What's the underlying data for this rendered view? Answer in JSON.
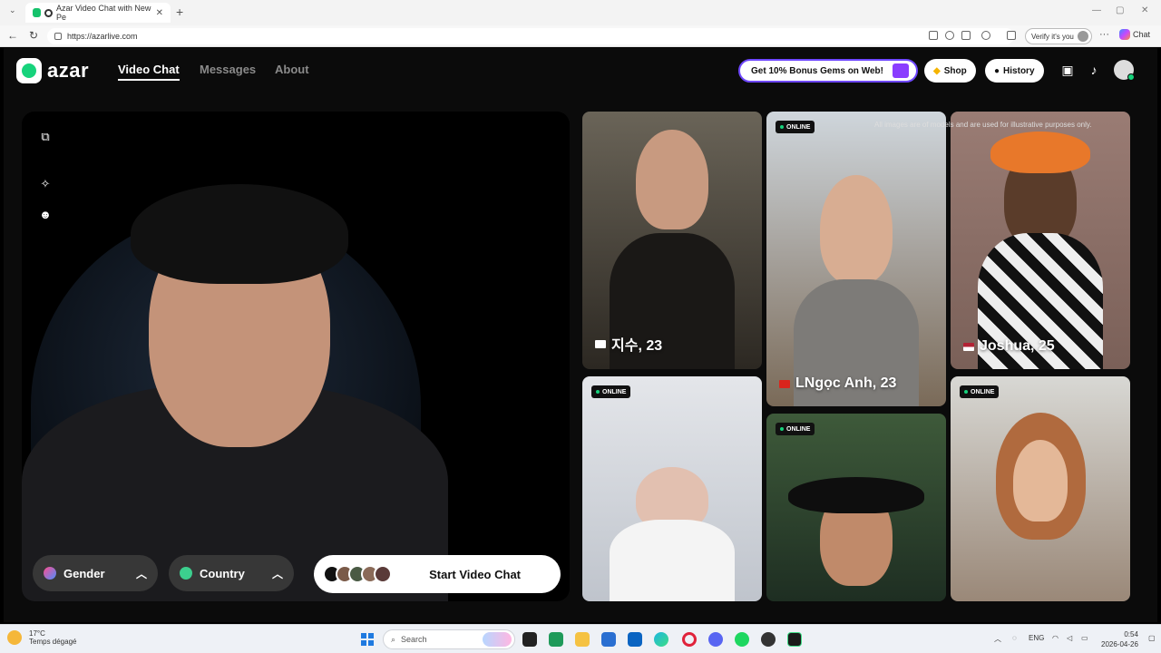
{
  "browser": {
    "tab_title": "Azar Video Chat with New Pe",
    "url": "https://azarlive.com",
    "verify_label": "Verify it's you",
    "copilot_label": "Chat"
  },
  "nav": {
    "logo_text": "azar",
    "links": [
      "Video Chat",
      "Messages",
      "About"
    ],
    "promo": "Get 10% Bonus Gems on Web!",
    "shop": "Shop",
    "history": "History"
  },
  "filters": {
    "gender": "Gender",
    "country": "Country",
    "start": "Start Video Chat"
  },
  "disclaimer": "All images are of models and are used for illustrative purposes only.",
  "profiles": [
    {
      "name": "지수, 23",
      "flag_color": "#ffffff",
      "online": false
    },
    {
      "name": "LNgọc Anh, 23",
      "flag_color": "#da251d",
      "online": true
    },
    {
      "name": "Joshua, 25",
      "flag_color": "#b22234",
      "online": false
    },
    {
      "name": "",
      "online": true
    },
    {
      "name": "",
      "online": true
    },
    {
      "name": "",
      "online": true
    }
  ],
  "online_label": "ONLINE",
  "taskbar": {
    "weather_temp": "17°C",
    "weather_desc": "Temps dégagé",
    "search": "Search",
    "lang": "ENG",
    "time": "0:54",
    "date": "2026-04-26"
  },
  "colors": {
    "accent": "#17d37c",
    "promo_border": "#6f48ff"
  }
}
